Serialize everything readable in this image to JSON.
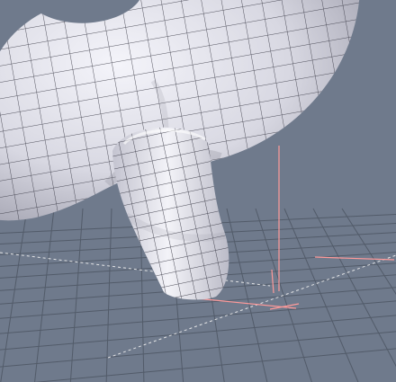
{
  "viewport": {
    "background_color": "#6f7a8c",
    "grid_color": "#4f5866",
    "axis_color": "#f0f0f0",
    "gizmo_color": "#ff9a9a",
    "mesh_face_color": "#dcdde6",
    "mesh_wire_color": "#3a3a46",
    "icons": {
      "object": "subdivided-mesh-object",
      "gizmo": "transform-gizmo-icon"
    }
  }
}
